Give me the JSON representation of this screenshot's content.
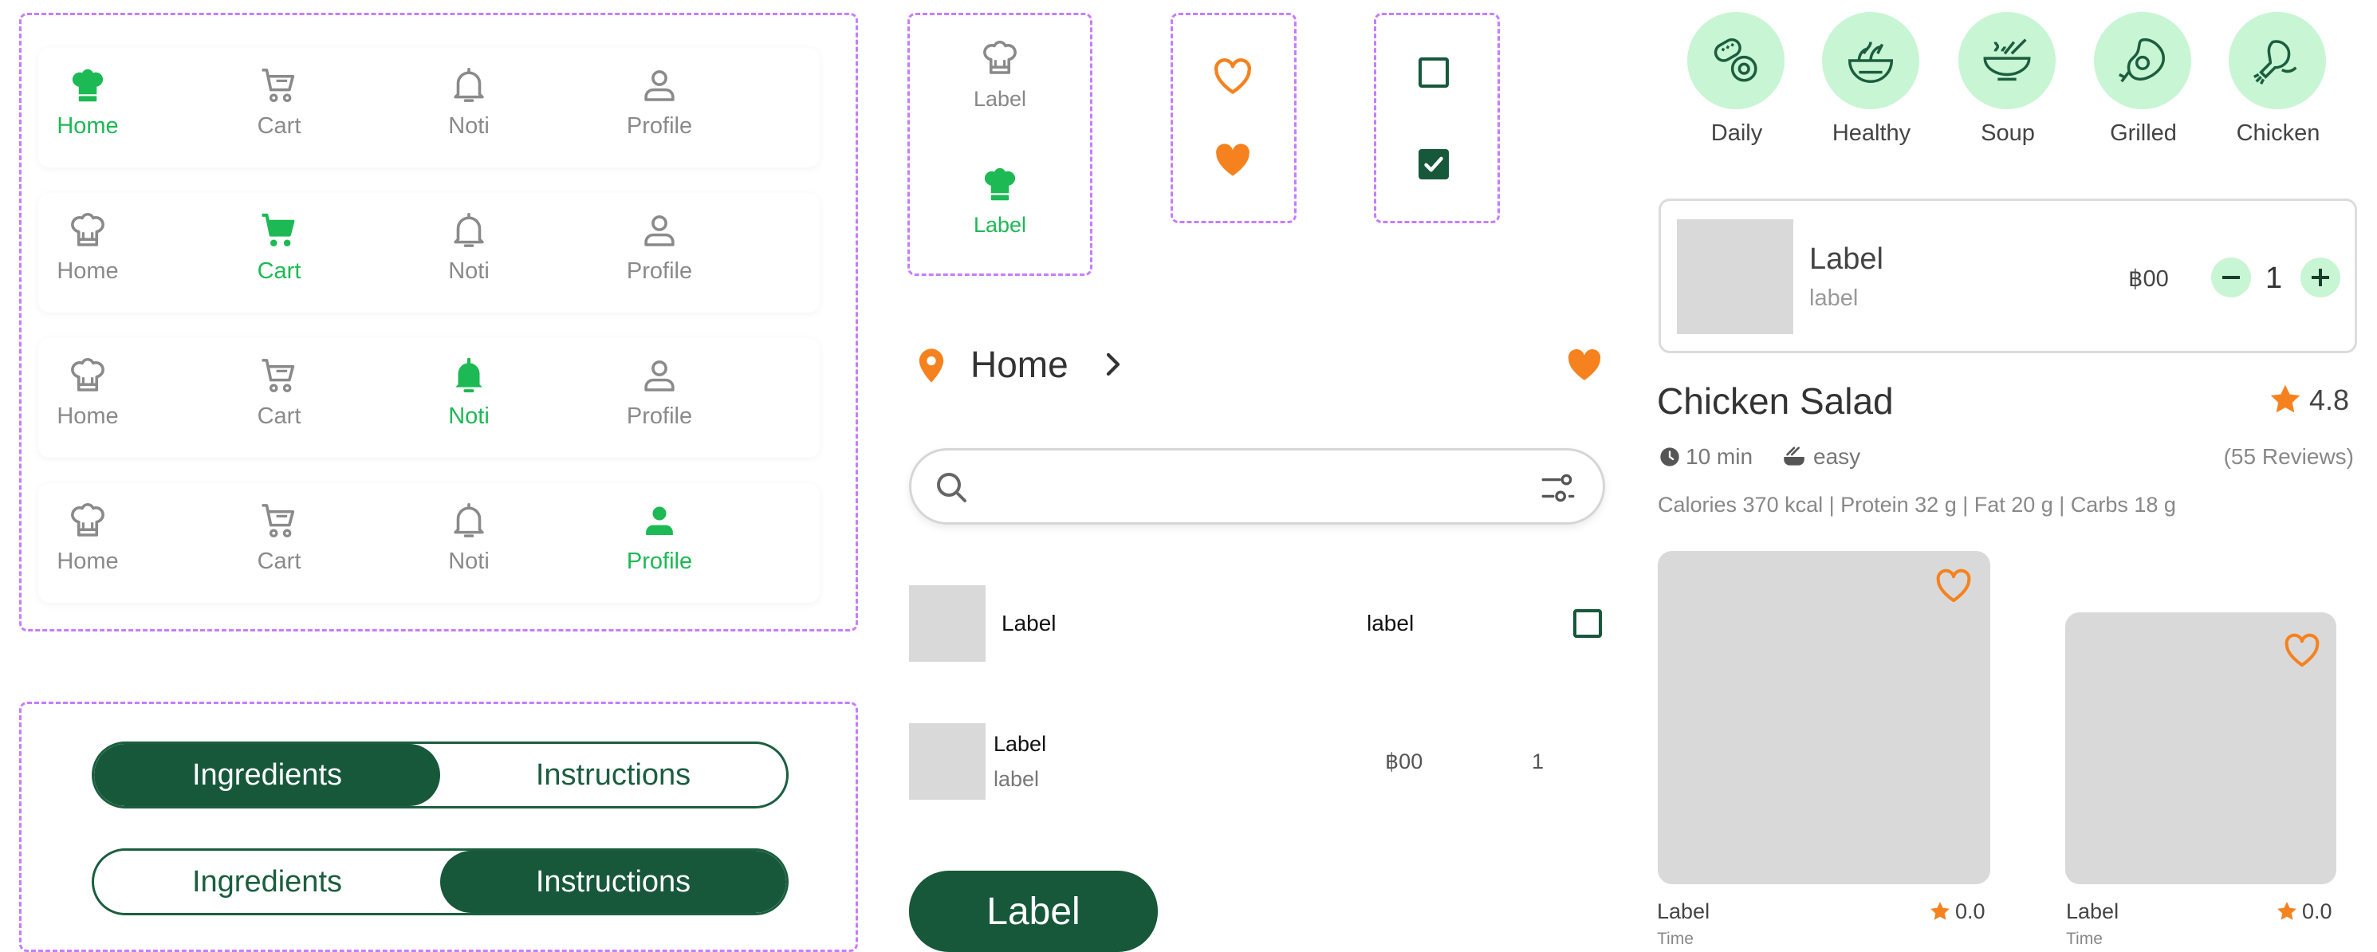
{
  "nav_bars": [
    {
      "active": 0,
      "items": [
        "Home",
        "Cart",
        "Noti",
        "Profile"
      ]
    },
    {
      "active": 1,
      "items": [
        "Home",
        "Cart",
        "Noti",
        "Profile"
      ]
    },
    {
      "active": 2,
      "items": [
        "Home",
        "Cart",
        "Noti",
        "Profile"
      ]
    },
    {
      "active": 3,
      "items": [
        "Home",
        "Cart",
        "Noti",
        "Profile"
      ]
    }
  ],
  "segmented": {
    "left": "Ingredients",
    "right": "Instructions"
  },
  "nav_tile": {
    "label_default": "Label",
    "label_active": "Label"
  },
  "location": {
    "text": "Home"
  },
  "search": {
    "placeholder": ""
  },
  "list_row_check": {
    "title": "Label",
    "value": "label"
  },
  "list_row_price": {
    "title": "Label",
    "subtitle": "label",
    "price": "฿00",
    "qty": "1"
  },
  "primary_button": {
    "label": "Label"
  },
  "categories": [
    "Daily",
    "Healthy",
    "Soup",
    "Grilled",
    "Chicken"
  ],
  "cart_item": {
    "title": "Label",
    "subtitle": "label",
    "price": "฿00",
    "qty": "1"
  },
  "recipe": {
    "title": "Chicken Salad",
    "rating": "4.8",
    "time": "10 min",
    "difficulty": "easy",
    "reviews": "(55 Reviews)",
    "nutrition": "Calories 370 kcal | Protein 32 g | Fat 20 g | Carbs 18 g"
  },
  "cards": [
    {
      "title": "Label",
      "rating": "0.0",
      "time": "Time"
    },
    {
      "title": "Label",
      "rating": "0.0",
      "time": "Time"
    }
  ],
  "colors": {
    "green_dark": "#17583b",
    "green_bright": "#1db954",
    "orange": "#f5821f",
    "mint": "#c8f5d3",
    "purple_dash": "#c77dff",
    "placeholder_gray": "#d9d9d9"
  },
  "icons": {
    "home": "chef-hat-icon",
    "cart": "cart-icon",
    "noti": "bell-icon",
    "profile": "person-icon",
    "heart": "heart-icon",
    "star": "star-icon",
    "pin": "location-pin-icon",
    "search": "search-icon",
    "filter": "filter-icon",
    "clock": "clock-icon",
    "pot": "pot-icon"
  }
}
